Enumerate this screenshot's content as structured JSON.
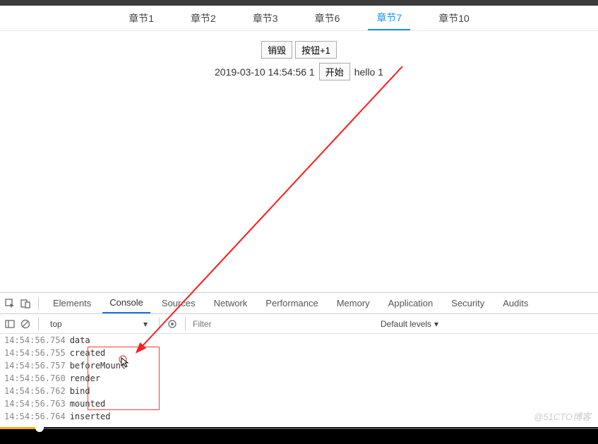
{
  "tabs": {
    "items": [
      {
        "label": "章节1",
        "active": false
      },
      {
        "label": "章节2",
        "active": false
      },
      {
        "label": "章节3",
        "active": false
      },
      {
        "label": "章节6",
        "active": false
      },
      {
        "label": "章节7",
        "active": true
      },
      {
        "label": "章节10",
        "active": false
      }
    ]
  },
  "content": {
    "destroy_label": "销毁",
    "button_plus_label": "按钮+1",
    "timestamp_text": "2019-03-10 14:54:56 1",
    "start_label": "开始",
    "hello_text": "hello 1"
  },
  "devtools": {
    "tabs": {
      "elements": "Elements",
      "console": "Console",
      "sources": "Sources",
      "network": "Network",
      "performance": "Performance",
      "memory": "Memory",
      "application": "Application",
      "security": "Security",
      "audits": "Audits"
    },
    "toolbar": {
      "context": "top",
      "filter_placeholder": "Filter",
      "levels": "Default levels"
    },
    "logs": [
      {
        "ts": "14:54:56.754",
        "msg": "data"
      },
      {
        "ts": "14:54:56.755",
        "msg": "created"
      },
      {
        "ts": "14:54:56.757",
        "msg": "beforeMount"
      },
      {
        "ts": "14:54:56.760",
        "msg": "render"
      },
      {
        "ts": "14:54:56.762",
        "msg": "bind"
      },
      {
        "ts": "14:54:56.763",
        "msg": "mounted"
      },
      {
        "ts": "14:54:56.764",
        "msg": "inserted"
      }
    ]
  },
  "watermark": "@51CTO博客"
}
